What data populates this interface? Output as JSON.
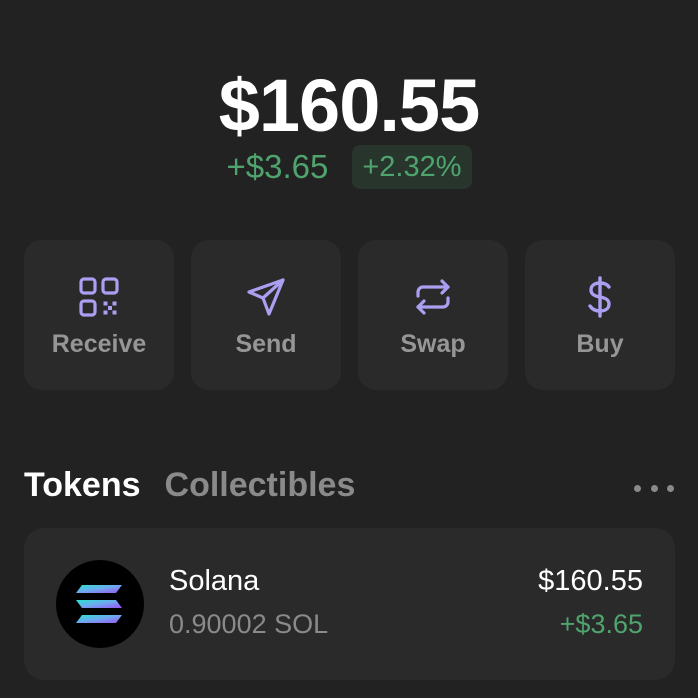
{
  "portfolio": {
    "balance": "$160.55",
    "change_amount": "+$3.65",
    "change_percent": "+2.32%"
  },
  "actions": [
    {
      "label": "Receive",
      "icon": "qr-code-icon"
    },
    {
      "label": "Send",
      "icon": "send-arrow-icon"
    },
    {
      "label": "Swap",
      "icon": "swap-arrows-icon"
    },
    {
      "label": "Buy",
      "icon": "dollar-icon"
    }
  ],
  "tabs": {
    "tokens": "Tokens",
    "collectibles": "Collectibles",
    "active": "tokens"
  },
  "tokens": [
    {
      "name": "Solana",
      "amount": "0.90002 SOL",
      "value": "$160.55",
      "change": "+$3.65",
      "icon": "solana-logo-icon"
    }
  ],
  "colors": {
    "background": "#222222",
    "card": "#2a2a2a",
    "accent": "#ab9ff2",
    "positive": "#4fa46e",
    "muted": "#969696"
  }
}
